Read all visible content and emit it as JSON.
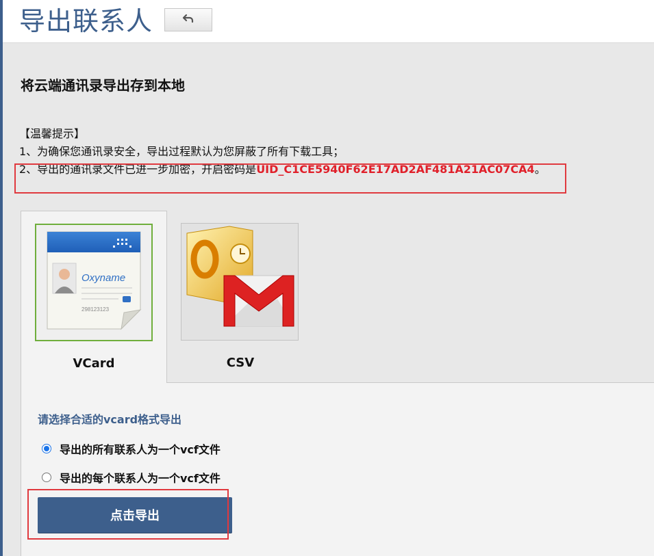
{
  "header": {
    "title": "导出联系人",
    "back_icon": "undo-arrow-icon"
  },
  "main": {
    "section_title": "将云端通讯录导出存到本地",
    "tips": {
      "heading": "【温馨提示】",
      "line1": "1、为确保您通讯录安全，导出过程默认为您屏蔽了所有下载工具；",
      "line2_prefix": "2、导出的通讯录文件已进一步加密，开启密码是",
      "password": "UID_C1CE5940F62E17AD2AF481A21AC07CA4",
      "line2_suffix": "。"
    },
    "tabs": [
      {
        "label": "VCard",
        "icon": "vcard-contact-icon",
        "selected": true,
        "card_name": "Oxyname",
        "card_number": "298123123"
      },
      {
        "label": "CSV",
        "icon": "outlook-gmail-icon",
        "selected": false
      }
    ],
    "panel": {
      "heading": "请选择合适的vcard格式导出",
      "options": [
        {
          "label": "导出的所有联系人为一个vcf文件",
          "checked": true
        },
        {
          "label": "导出的每个联系人为一个vcf文件",
          "checked": false
        }
      ],
      "export_button": "点击导出"
    }
  },
  "colors": {
    "accent": "#3d5f8c",
    "highlight_border": "#e0393e",
    "password_red": "#e0202a",
    "selected_tab_border": "#6fae3c",
    "radio_blue": "#1a73e8"
  }
}
